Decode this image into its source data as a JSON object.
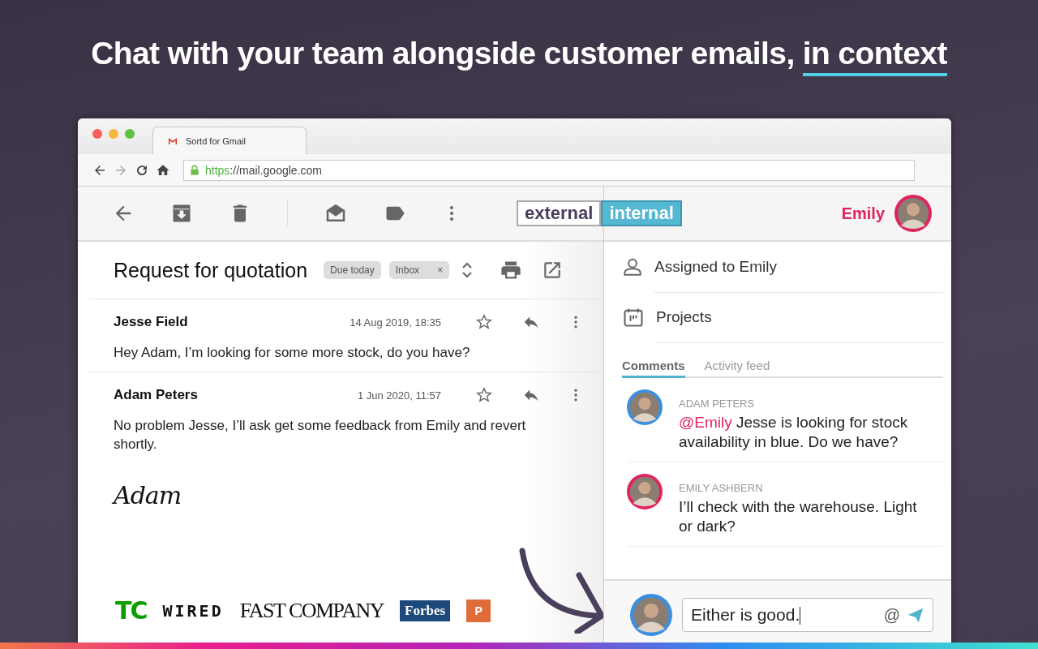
{
  "headline": {
    "text": "Chat with your team alongside customer emails,",
    "highlight": "in context"
  },
  "browser": {
    "tab_title": "Sortd for Gmail",
    "url_scheme": "https",
    "url_rest": "://mail.google.com"
  },
  "toolbar": {
    "view_toggle": [
      {
        "label": "external",
        "selected": false
      },
      {
        "label": "internal",
        "selected": true
      }
    ],
    "user_name": "Emily"
  },
  "email": {
    "subject": "Request for quotation",
    "tags": [
      {
        "label": "Due today"
      },
      {
        "label": "Inbox",
        "close": "×"
      }
    ],
    "messages": [
      {
        "sender": "Jesse Field",
        "date": "14 Aug 2019, 18:35",
        "body": "Hey Adam, I’m looking for some more stock, do you have?"
      },
      {
        "sender": "Adam Peters",
        "date": "1 Jun 2020, 11:57",
        "body": "No problem Jesse, I’ll ask get some feedback from Emily and revert shortly.",
        "signature": "Adam"
      }
    ]
  },
  "press_logos": [
    {
      "kind": "tc",
      "text": "TC"
    },
    {
      "kind": "wired",
      "text": "WIRED"
    },
    {
      "kind": "fastcompany",
      "text": "FAST COMPANY"
    },
    {
      "kind": "forbes",
      "text": "Forbes"
    },
    {
      "kind": "badge",
      "text": "P"
    }
  ],
  "panel": {
    "properties": [
      {
        "kind": "person",
        "label": "Assigned to Emily"
      },
      {
        "kind": "calendar",
        "label": "Projects"
      }
    ],
    "tabs": [
      {
        "label": "Comments",
        "selected": true
      },
      {
        "label": "Activity feed",
        "selected": false
      }
    ],
    "comments": [
      {
        "author": "ADAM PETERS",
        "mention": "@Emily",
        "text": "Jesse is looking for stock availability in blue. Do we have?",
        "color": "#3b8fe0"
      },
      {
        "author": "EMILY ASHBERN",
        "text": "I’ll check with the warehouse. Light or dark?",
        "color": "#e0245e"
      }
    ],
    "compose": {
      "value": "Either is good.",
      "mention_button": "@"
    }
  }
}
